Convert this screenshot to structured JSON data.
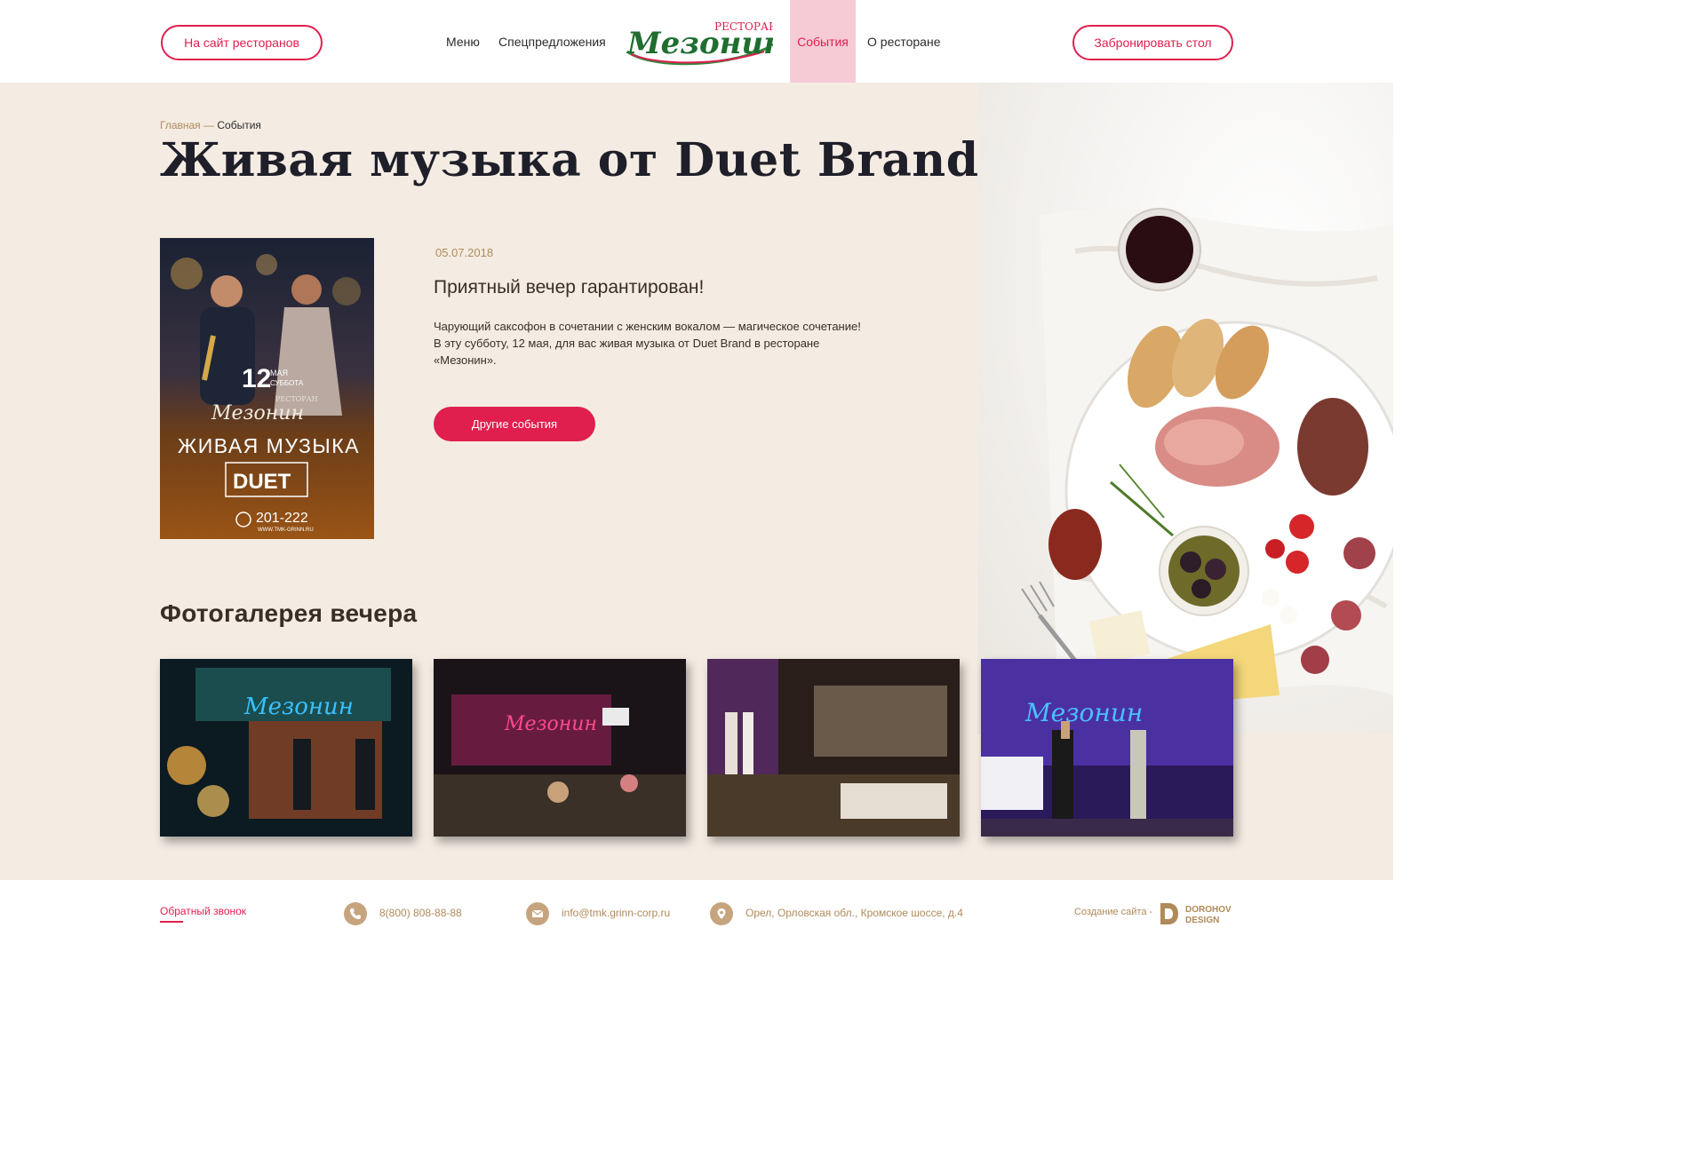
{
  "header": {
    "sites_button": "На сайт ресторанов",
    "nav": [
      "Меню",
      "Спецпредложения",
      "События",
      "О ресторане"
    ],
    "active_nav": "События",
    "book_button": "Забронировать стол",
    "logo_caption": "РЕСТОРАН",
    "logo_name": "Мезонин"
  },
  "breadcrumb": {
    "home": "Главная",
    "separator": " — ",
    "current": "События"
  },
  "page_title": "Живая музыка от Duet Brand",
  "event": {
    "date": "05.07.2018",
    "subheading": "Приятный вечер гарантирован!",
    "description_1": "Чарующий саксофон в сочетании с женским вокалом — магическое сочетание!",
    "description_2": "В эту субботу,  12 мая, для вас живая музыка от Duet Brand в ресторане «Мезонин».",
    "other_events_button": "Другие события"
  },
  "poster": {
    "day": "12",
    "month": "МАЯ",
    "weekday": "СУББОТА",
    "caption": "РЕСТОРАН",
    "name": "Мезонин",
    "headline": "ЖИВАЯ МУЗЫКА",
    "band": "DUET",
    "phone": "201-222",
    "site": "WWW.TMK-GRINN.RU"
  },
  "gallery": {
    "title": "Фотогалерея вечера",
    "photos": [
      "photo-1",
      "photo-2",
      "photo-3",
      "photo-4"
    ]
  },
  "footer": {
    "callback": "Обратный звонок",
    "phone": "8(800) 808-88-88",
    "email": "info@tmk.grinn-corp.ru",
    "address": "Орел, Орловская обл., Кромское шоссе, д.4",
    "credit": "Создание сайта -",
    "studio_line1": "DOROHOV",
    "studio_line2": "DESIGN"
  },
  "colors": {
    "accent": "#e01f4e",
    "gold": "#b08a5a",
    "background": "#f4ece3",
    "active_nav_bg": "#f6cbd6"
  },
  "icons": [
    "phone-icon",
    "mail-icon",
    "location-icon"
  ]
}
